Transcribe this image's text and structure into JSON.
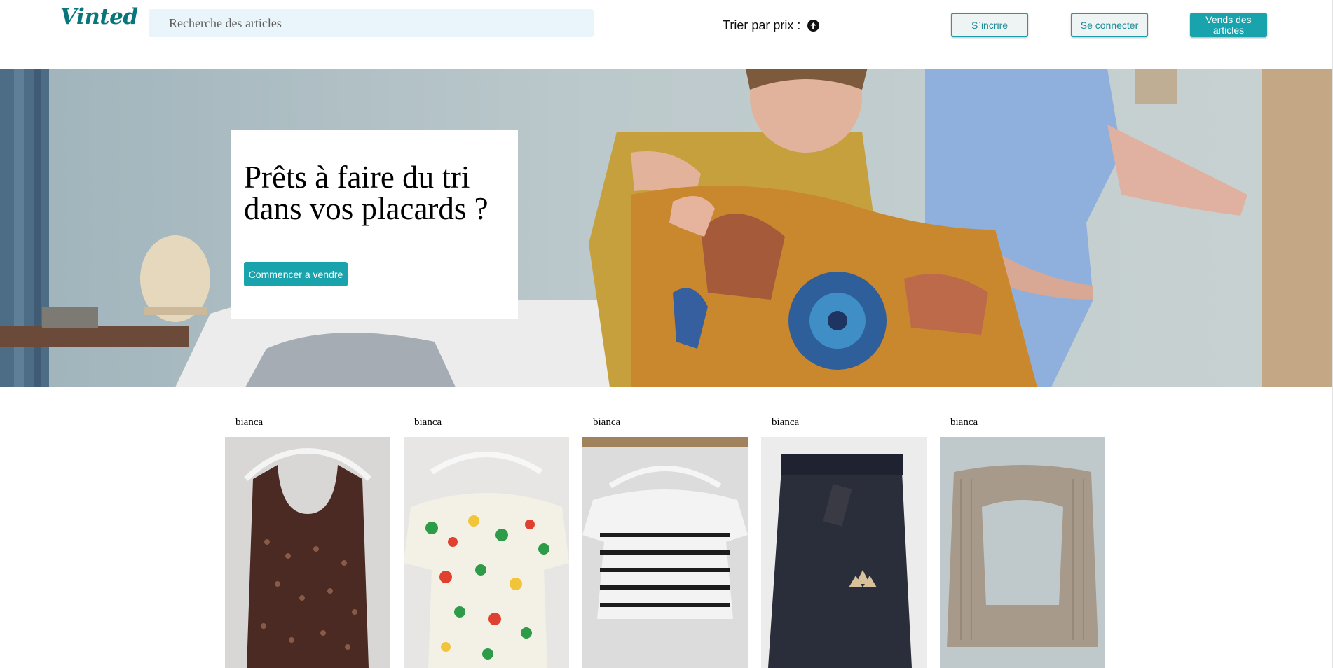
{
  "header": {
    "logo": "Vinted",
    "search_placeholder": "Recherche des articles",
    "sort_label": "Trier par prix :",
    "sort_icon": "arrow-up-circle-icon",
    "signup_label": "S`incrire",
    "login_label": "Se connecter",
    "sell_label": "Vends des articles"
  },
  "hero": {
    "title": "Prêts à faire du tri dans vos placards ?",
    "cta_label": "Commencer a vendre"
  },
  "products": [
    {
      "seller": "bianca",
      "item": "brown sequin tank top"
    },
    {
      "seller": "bianca",
      "item": "floral off-shoulder top"
    },
    {
      "seller": "bianca",
      "item": "striped crop top"
    },
    {
      "seller": "bianca",
      "item": "navy sport shorts"
    },
    {
      "seller": "bianca",
      "item": "beige ribbed cutout top"
    }
  ],
  "colors": {
    "brand": "#09767b",
    "accent": "#19a3ad",
    "search_bg": "#eaf5fb"
  }
}
